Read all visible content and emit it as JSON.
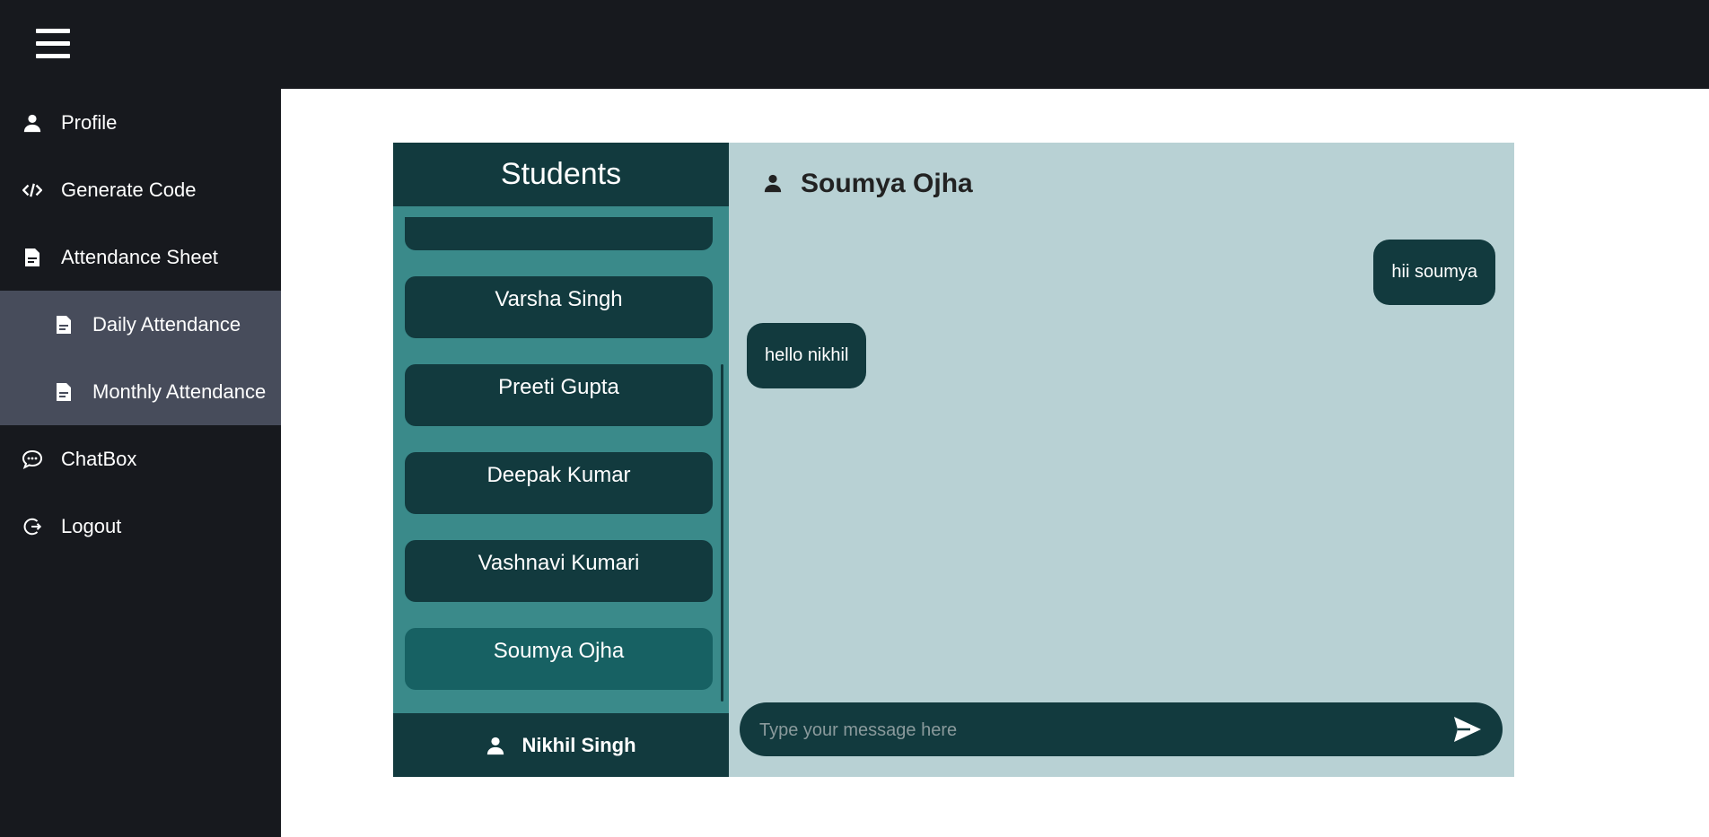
{
  "sidebar": {
    "items": [
      {
        "label": "Profile",
        "icon": "user-icon"
      },
      {
        "label": "Generate Code",
        "icon": "code-icon"
      },
      {
        "label": "Attendance Sheet",
        "icon": "document-icon"
      },
      {
        "label": "Daily Attendance",
        "icon": "document-icon"
      },
      {
        "label": "Monthly Attendance",
        "icon": "document-icon"
      },
      {
        "label": "ChatBox",
        "icon": "chat-icon"
      },
      {
        "label": "Logout",
        "icon": "logout-icon"
      }
    ]
  },
  "students": {
    "title": "Students",
    "list": [
      "Varsha Singh",
      "Preeti Gupta",
      "Deepak Kumar",
      "Vashnavi Kumari",
      "Soumya Ojha"
    ],
    "active": "Soumya Ojha",
    "current_user": "Nikhil Singh"
  },
  "chat": {
    "contact_name": "Soumya Ojha",
    "messages": [
      {
        "text": "hii soumya",
        "direction": "sent"
      },
      {
        "text": "hello nikhil",
        "direction": "received"
      }
    ],
    "input_placeholder": "Type your message here"
  },
  "colors": {
    "sidebar_bg": "#17191e",
    "submenu_bg": "#474c5b",
    "dark_teal": "#123a3e",
    "list_bg": "#3a8a8a",
    "active_card": "#176163",
    "chat_bg": "#b8d1d4"
  }
}
